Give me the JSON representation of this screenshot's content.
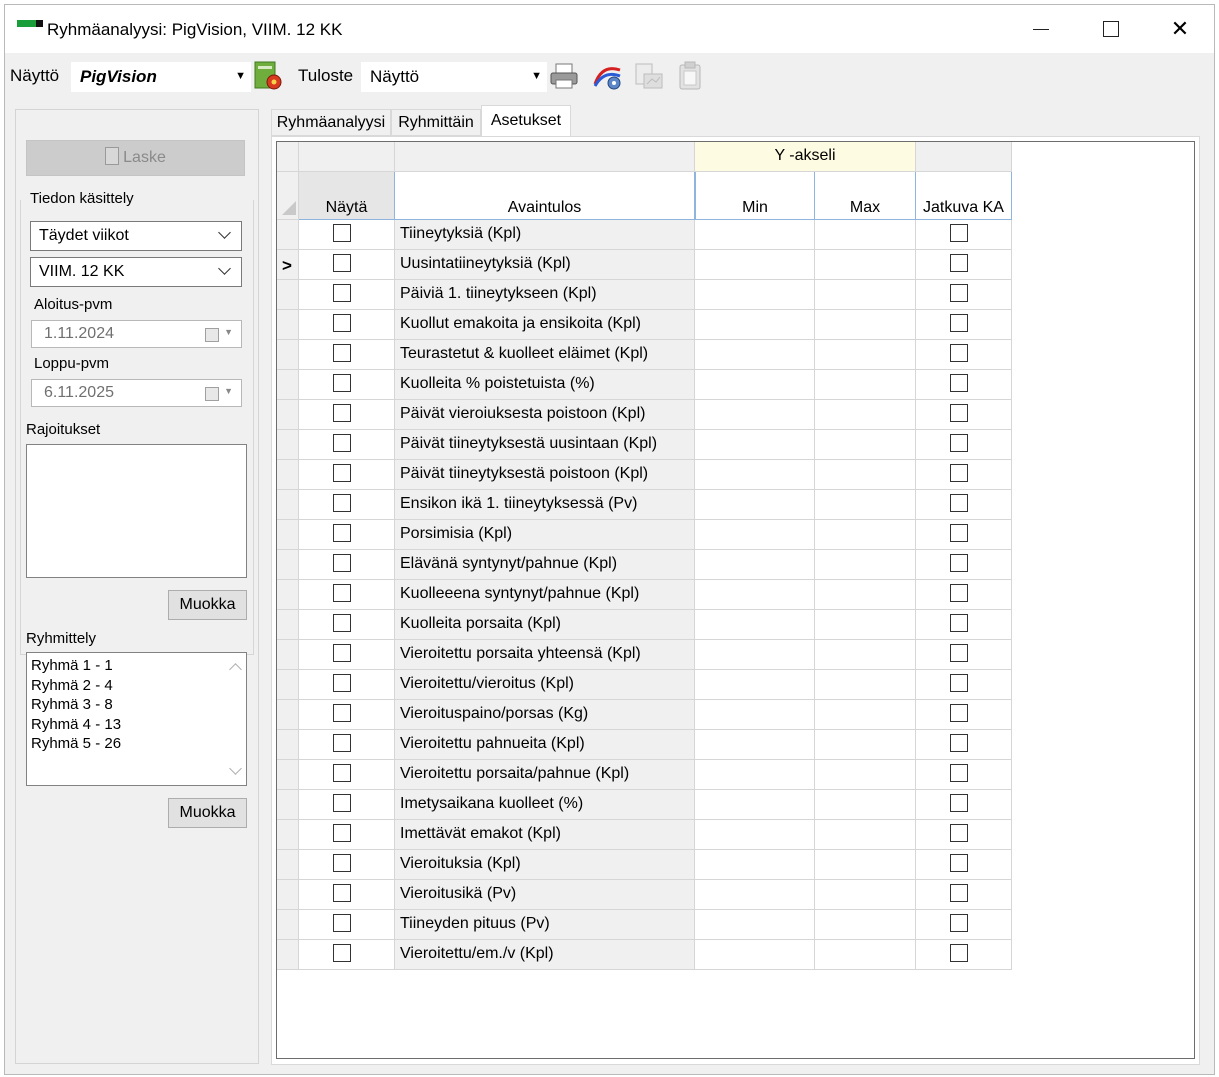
{
  "window": {
    "title": "Ryhmäanalyysi: PigVision, VIIM. 12 KK",
    "close_glyph": "✕"
  },
  "toolbar": {
    "view_label": "Näyttö",
    "view_value": "PigVision",
    "print_label": "Tuloste",
    "print_value": "Näyttö"
  },
  "left_panel": {
    "calc_button": "Laske",
    "data_handling_label": "Tiedon käsittely",
    "period_type": "Täydet viikot",
    "period": "VIIM. 12 KK",
    "start_date_label": "Aloitus-pvm",
    "start_date": "1.11.2024",
    "end_date_label": "Loppu-pvm",
    "end_date": "6.11.2025",
    "restrictions_label": "Rajoitukset",
    "edit_button_1": "Muokka",
    "grouping_label": "Ryhmittely",
    "groups": [
      "Ryhmä 1 - 1",
      "Ryhmä 2 - 4",
      "Ryhmä 3 - 8",
      "Ryhmä 4 - 13",
      "Ryhmä 5 - 26"
    ],
    "edit_button_2": "Muokka"
  },
  "tabs": [
    "Ryhmäanalyysi",
    "Ryhmittäin",
    "Asetukset"
  ],
  "active_tab": "Asetukset",
  "grid": {
    "y_axis_header": "Y -akseli",
    "col_show": "Näytä",
    "col_key_result": "Avaintulos",
    "col_min": "Min",
    "col_max": "Max",
    "col_continuous": "Jatkuva KA",
    "current_row_marker": ">",
    "rows": [
      {
        "name": "Tiineytyksiä (Kpl)",
        "show": false,
        "min": "",
        "max": "",
        "continuous": false
      },
      {
        "name": "Uusintatiineytyksiä (Kpl)",
        "show": false,
        "min": "",
        "max": "",
        "continuous": false
      },
      {
        "name": "Päiviä 1. tiineytykseen (Kpl)",
        "show": false,
        "min": "",
        "max": "",
        "continuous": false
      },
      {
        "name": "Kuollut emakoita ja ensikoita (Kpl)",
        "show": false,
        "min": "",
        "max": "",
        "continuous": false
      },
      {
        "name": "Teurastetut & kuolleet eläimet (Kpl)",
        "show": false,
        "min": "",
        "max": "",
        "continuous": false
      },
      {
        "name": "Kuolleita % poistetuista (%)",
        "show": false,
        "min": "",
        "max": "",
        "continuous": false
      },
      {
        "name": "Päivät vieroiuksesta poistoon (Kpl)",
        "show": false,
        "min": "",
        "max": "",
        "continuous": false
      },
      {
        "name": "Päivät tiineytyksestä uusintaan (Kpl)",
        "show": false,
        "min": "",
        "max": "",
        "continuous": false
      },
      {
        "name": "Päivät tiineytyksestä poistoon (Kpl)",
        "show": false,
        "min": "",
        "max": "",
        "continuous": false
      },
      {
        "name": "Ensikon ikä 1. tiineytyksessä (Pv)",
        "show": false,
        "min": "",
        "max": "",
        "continuous": false
      },
      {
        "name": "Porsimisia (Kpl)",
        "show": false,
        "min": "",
        "max": "",
        "continuous": false
      },
      {
        "name": "Elävänä syntynyt/pahnue (Kpl)",
        "show": false,
        "min": "",
        "max": "",
        "continuous": false
      },
      {
        "name": "Kuolleeena syntynyt/pahnue (Kpl)",
        "show": false,
        "min": "",
        "max": "",
        "continuous": false
      },
      {
        "name": "Kuolleita porsaita (Kpl)",
        "show": false,
        "min": "",
        "max": "",
        "continuous": false
      },
      {
        "name": "Vieroitettu porsaita yhteensä (Kpl)",
        "show": false,
        "min": "",
        "max": "",
        "continuous": false
      },
      {
        "name": "Vieroitettu/vieroitus (Kpl)",
        "show": false,
        "min": "",
        "max": "",
        "continuous": false
      },
      {
        "name": "Vieroituspaino/porsas (Kg)",
        "show": false,
        "min": "",
        "max": "",
        "continuous": false
      },
      {
        "name": "Vieroitettu pahnueita (Kpl)",
        "show": false,
        "min": "",
        "max": "",
        "continuous": false
      },
      {
        "name": "Vieroitettu porsaita/pahnue (Kpl)",
        "show": false,
        "min": "",
        "max": "",
        "continuous": false
      },
      {
        "name": "Imetysaikana kuolleet (%)",
        "show": false,
        "min": "",
        "max": "",
        "continuous": false
      },
      {
        "name": "Imettävät emakot (Kpl)",
        "show": false,
        "min": "",
        "max": "",
        "continuous": false
      },
      {
        "name": "Vieroituksia (Kpl)",
        "show": false,
        "min": "",
        "max": "",
        "continuous": false
      },
      {
        "name": "Vieroitusikä (Pv)",
        "show": false,
        "min": "",
        "max": "",
        "continuous": false
      },
      {
        "name": "Tiineyden pituus (Pv)",
        "show": false,
        "min": "",
        "max": "",
        "continuous": false
      },
      {
        "name": "Vieroitettu/em./v (Kpl)",
        "show": false,
        "min": "",
        "max": "",
        "continuous": false
      }
    ],
    "current_row_index": 1
  }
}
